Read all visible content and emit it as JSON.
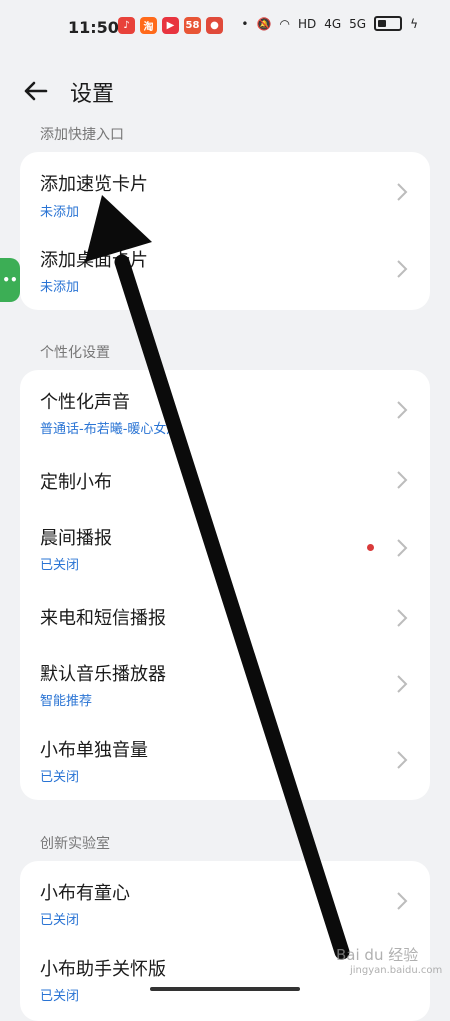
{
  "status_bar": {
    "time": "11:50",
    "app_icons": [
      {
        "name": "music-app-icon",
        "glyph": "♪",
        "color": "#e8423a"
      },
      {
        "name": "taobao-app-icon",
        "glyph": "淘",
        "color": "#ff6a1a"
      },
      {
        "name": "video-app-icon",
        "glyph": "▶",
        "color": "#e8343f"
      },
      {
        "name": "game-app-icon",
        "glyph": "58",
        "color": "#e85535"
      },
      {
        "name": "location-app-icon",
        "glyph": "●",
        "color": "#e04a3a"
      }
    ],
    "network": "HD",
    "signal1": "4G",
    "signal2": "5G"
  },
  "header": {
    "title": "设置"
  },
  "sections": [
    {
      "title": "添加快捷入口",
      "rows": [
        {
          "label": "添加速览卡片",
          "sub": "未添加"
        },
        {
          "label": "添加桌面卡片",
          "sub": "未添加"
        }
      ]
    },
    {
      "title": "个性化设置",
      "rows": [
        {
          "label": "个性化声音",
          "sub": "普通话-布若曦-暖心女声"
        },
        {
          "label": "定制小布",
          "sub": ""
        },
        {
          "label": "晨间播报",
          "sub": "已关闭"
        },
        {
          "label": "来电和短信播报",
          "sub": ""
        },
        {
          "label": "默认音乐播放器",
          "sub": "智能推荐"
        },
        {
          "label": "小布单独音量",
          "sub": "已关闭"
        }
      ]
    },
    {
      "title": "创新实验室",
      "rows": [
        {
          "label": "小布有童心",
          "sub": "已关闭"
        },
        {
          "label": "小布助手关怀版",
          "sub": "已关闭"
        }
      ]
    }
  ],
  "side_tab": {
    "glyph": "••"
  },
  "watermark": {
    "text": "Bai du 经验",
    "sub": "jingyan.baidu.com"
  },
  "colors": {
    "accent": "#2a74d4",
    "background": "#f1f2f4",
    "card": "#ffffff",
    "notice_dot": "#d93a3a",
    "side_tab": "#3cae55"
  }
}
